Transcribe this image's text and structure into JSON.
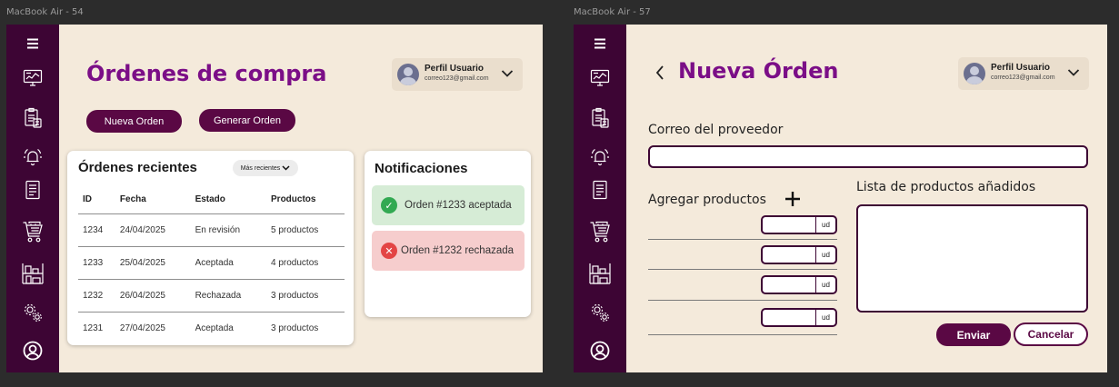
{
  "screens": [
    {
      "frame_label": "MacBook Air - 54",
      "title": "Órdenes de compra",
      "profile": {
        "name": "Perfil Usuario",
        "email": "correo123@gmail.com"
      },
      "buttons": {
        "new_order": "Nueva Orden",
        "generate_order": "Generar Orden"
      },
      "recent_orders": {
        "title": "Órdenes recientes",
        "sort_label": "Más recientes",
        "columns": [
          "ID",
          "Fecha",
          "Estado",
          "Productos"
        ],
        "rows": [
          [
            "1234",
            "24/04/2025",
            "En revisión",
            "5 productos"
          ],
          [
            "1233",
            "25/04/2025",
            "Aceptada",
            "4 productos"
          ],
          [
            "1232",
            "26/04/2025",
            "Rechazada",
            "3 productos"
          ],
          [
            "1231",
            "27/04/2025",
            "Aceptada",
            "3 productos"
          ]
        ]
      },
      "notifications": {
        "title": "Notificaciones",
        "items": [
          {
            "text": "Orden #1233 aceptada",
            "status": "accepted",
            "icon": "check-icon"
          },
          {
            "text": "Orden #1232 rechazada",
            "status": "rejected",
            "icon": "x-icon"
          }
        ]
      }
    },
    {
      "frame_label": "MacBook Air - 57",
      "title": "Nueva Órden",
      "profile": {
        "name": "Perfil Usuario",
        "email": "correo123@gmail.com"
      },
      "supplier_email_label": "Correo del proveedor",
      "supplier_email_value": "",
      "add_products_label": "Agregar productos",
      "unit_label": "ud",
      "product_rows": 4,
      "added_list_label": "Lista de productos añadidos",
      "buttons": {
        "send": "Enviar",
        "cancel": "Cancelar"
      }
    }
  ],
  "sidebar_icons": [
    "menu-icon",
    "dashboard-icon",
    "orders-icon",
    "alarm-icon",
    "document-icon",
    "cart-icon",
    "warehouse-icon",
    "settings-icon",
    "user-icon"
  ],
  "colors": {
    "sidebar": "#3d0534",
    "accent": "#7b0e87",
    "button": "#5a0844",
    "background": "#f4eadb",
    "success": "#32a952",
    "error": "#e34545"
  }
}
